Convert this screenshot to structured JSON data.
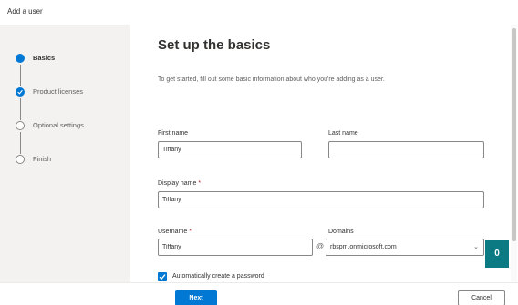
{
  "window": {
    "title": "Add a user"
  },
  "steps": [
    {
      "label": "Basics",
      "state": "current"
    },
    {
      "label": "Product licenses",
      "state": "done"
    },
    {
      "label": "Optional settings",
      "state": "todo"
    },
    {
      "label": "Finish",
      "state": "todo"
    }
  ],
  "main": {
    "heading": "Set up the basics",
    "description": "To get started, fill out some basic information about who you're adding as a user."
  },
  "fields": {
    "first_name": {
      "label": "First name",
      "value": "Tiffany"
    },
    "last_name": {
      "label": "Last name",
      "value": ""
    },
    "display_name": {
      "label": "Display name",
      "required_mark": "*",
      "value": "Tiffany"
    },
    "username": {
      "label": "Username",
      "required_mark": "*",
      "value": "Tiffany"
    },
    "at_symbol": "@",
    "domains": {
      "label": "Domains",
      "value": "rbspm.onmicrosoft.com"
    },
    "auto_password": {
      "label": "Automatically create a password",
      "checked": true
    }
  },
  "footer": {
    "next_label": "Next",
    "cancel_label": "Cancel"
  },
  "help_button": {
    "label": "0"
  },
  "colors": {
    "accent": "#0078d4",
    "sidebar_bg": "#f3f2f1",
    "help_bg": "#0b7a83"
  }
}
